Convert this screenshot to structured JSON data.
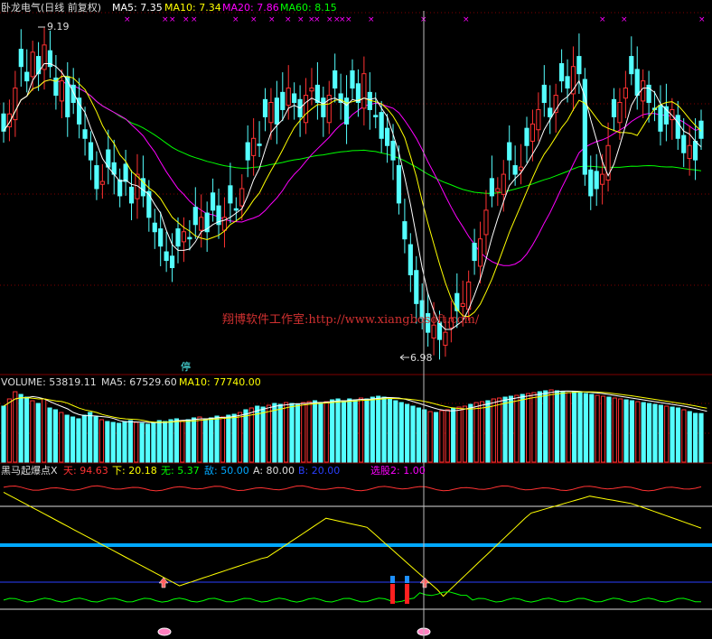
{
  "main_panel": {
    "header": {
      "title": "卧龙电气(日线 前复权)",
      "ma5_label": "MA5: 7.35",
      "ma10_label": "MA10: 7.34",
      "ma20_label": "MA20: 7.86",
      "ma60_label": "MA60: 8.15"
    },
    "high_label": "9.19",
    "low_label": "6.98",
    "halt_label": "停",
    "watermark": "翔博软件工作室:http://www.xiangbosoft.com/"
  },
  "volume_panel": {
    "header": {
      "volume_label": "VOLUME: 53819.11",
      "ma5_label": "MA5: 67529.60",
      "ma10_label": "MA10: 77740.00"
    }
  },
  "indicator_panel": {
    "header": {
      "name": "黑马起爆点X",
      "tian_label": "天: 94.63",
      "xia_label": "下: 20.18",
      "wu_label": "无: 5.37",
      "di_label": "敌: 50.00",
      "a_label": "A: 80.00",
      "b_label": "B: 20.00",
      "select_label": "选股2: 1.00"
    }
  },
  "colors": {
    "up": "#ff3232",
    "down": "#54ffff",
    "ma5": "#ffffff",
    "ma10": "#ffff00",
    "ma20": "#ff00ff",
    "ma60": "#00ff00",
    "grid": "#800000",
    "cursor": "#c0c0c0",
    "thick_line": "#00a8ff"
  },
  "chart_data": [
    {
      "type": "candlestick",
      "title": "卧龙电气(日线 前复权)",
      "ylim": [
        6.9,
        9.3
      ],
      "y_high": 9.19,
      "y_low": 6.98,
      "closes": [
        8.5,
        8.62,
        8.8,
        8.95,
        8.85,
        9.05,
        8.9,
        9.1,
        8.95,
        8.75,
        8.85,
        8.6,
        8.7,
        8.55,
        8.45,
        8.3,
        8.1,
        8.15,
        8.25,
        8.2,
        8.05,
        8.15,
        8.0,
        8.2,
        8.05,
        7.9,
        7.8,
        7.7,
        7.6,
        7.55,
        7.7,
        7.8,
        7.75,
        7.85,
        7.9,
        7.8,
        7.95,
        7.85,
        7.9,
        8.0,
        7.95,
        8.1,
        8.3,
        8.45,
        8.4,
        8.6,
        8.7,
        8.55,
        8.65,
        8.8,
        8.7,
        8.6,
        8.75,
        8.8,
        8.7,
        8.6,
        8.75,
        8.8,
        8.7,
        8.55,
        8.8,
        8.7,
        8.9,
        8.65,
        8.6,
        8.45,
        8.4,
        8.3,
        8.0,
        7.75,
        7.5,
        7.3,
        7.2,
        7.1,
        7.15,
        7.05,
        7.1,
        7.2,
        7.25,
        7.3,
        7.45,
        7.6,
        7.75,
        7.95,
        8.05,
        8.1,
        8.2,
        8.3,
        8.2,
        8.25,
        8.4,
        8.55,
        8.65,
        8.7,
        8.6,
        8.75,
        8.85,
        8.8,
        8.95,
        8.9,
        8.2,
        8.05,
        8.1,
        8.2,
        8.4,
        8.6,
        8.7,
        8.8,
        8.9,
        8.75,
        8.85,
        8.7,
        8.65,
        8.5,
        8.55,
        8.65,
        8.45,
        8.35,
        8.4,
        8.3,
        8.45
      ]
    },
    {
      "type": "bar",
      "title": "VOLUME",
      "values": [
        62000,
        70000,
        78000,
        75000,
        72000,
        68000,
        65000,
        70000,
        60000,
        58000,
        55000,
        52000,
        50000,
        48000,
        52000,
        55000,
        50000,
        47000,
        45000,
        44000,
        43000,
        45000,
        46000,
        44000,
        43000,
        42000,
        44000,
        46000,
        45000,
        47000,
        48000,
        46000,
        47000,
        49000,
        50000,
        48000,
        49000,
        51000,
        50000,
        52000,
        53000,
        55000,
        58000,
        60000,
        62000,
        61000,
        63000,
        65000,
        64000,
        66000,
        65000,
        64000,
        66000,
        67000,
        68000,
        66000,
        67000,
        69000,
        70000,
        68000,
        70000,
        69000,
        71000,
        70000,
        72000,
        73000,
        72000,
        70000,
        68000,
        66000,
        64000,
        62000,
        60000,
        58000,
        56000,
        55000,
        57000,
        58000,
        60000,
        61000,
        62000,
        64000,
        66000,
        67000,
        68000,
        70000,
        71000,
        72000,
        73000,
        74000,
        75000,
        76000,
        77000,
        78000,
        79000,
        80000,
        79000,
        78000,
        77000,
        78000,
        77000,
        76000,
        75000,
        74000,
        73000,
        72000,
        71000,
        70000,
        69000,
        68000,
        67000,
        66000,
        65000,
        64000,
        63000,
        62000,
        61000,
        60000,
        58000,
        56000,
        54000,
        53819.11
      ],
      "ma5": 67529.6,
      "ma10": 77740.0
    },
    {
      "type": "line",
      "title": "黑马起爆点X",
      "series": [
        {
          "name": "天",
          "value": 94.63
        },
        {
          "name": "下",
          "value": 20.18
        },
        {
          "name": "无",
          "value": 5.37
        },
        {
          "name": "敌",
          "value": 50.0
        },
        {
          "name": "A",
          "value": 80.0
        },
        {
          "name": "B",
          "value": 20.0
        },
        {
          "name": "选股2",
          "value": 1.0
        }
      ]
    }
  ]
}
